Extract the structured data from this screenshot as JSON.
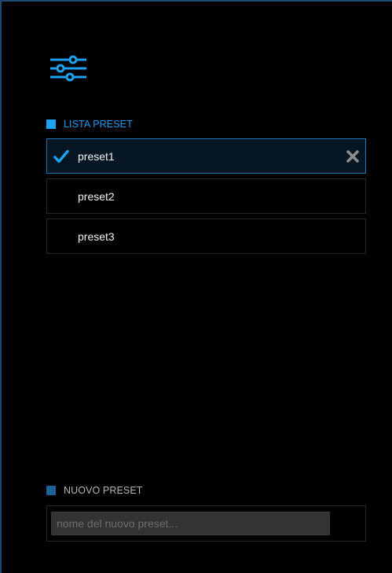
{
  "icons": {
    "settings": "sliders-icon",
    "selected": "checkmark-icon",
    "delete": "close-icon"
  },
  "colors": {
    "accent": "#1da1f2",
    "background": "#000000",
    "active_border": "#1e73b4",
    "new_preset_square": "#1e5f94"
  },
  "preset_list": {
    "header": "LISTA PRESET",
    "items": [
      {
        "label": "preset1",
        "selected": true
      },
      {
        "label": "preset2",
        "selected": false
      },
      {
        "label": "preset3",
        "selected": false
      }
    ]
  },
  "new_preset": {
    "header": "NUOVO PRESET",
    "value": "",
    "placeholder": "nome del nuovo preset..."
  }
}
